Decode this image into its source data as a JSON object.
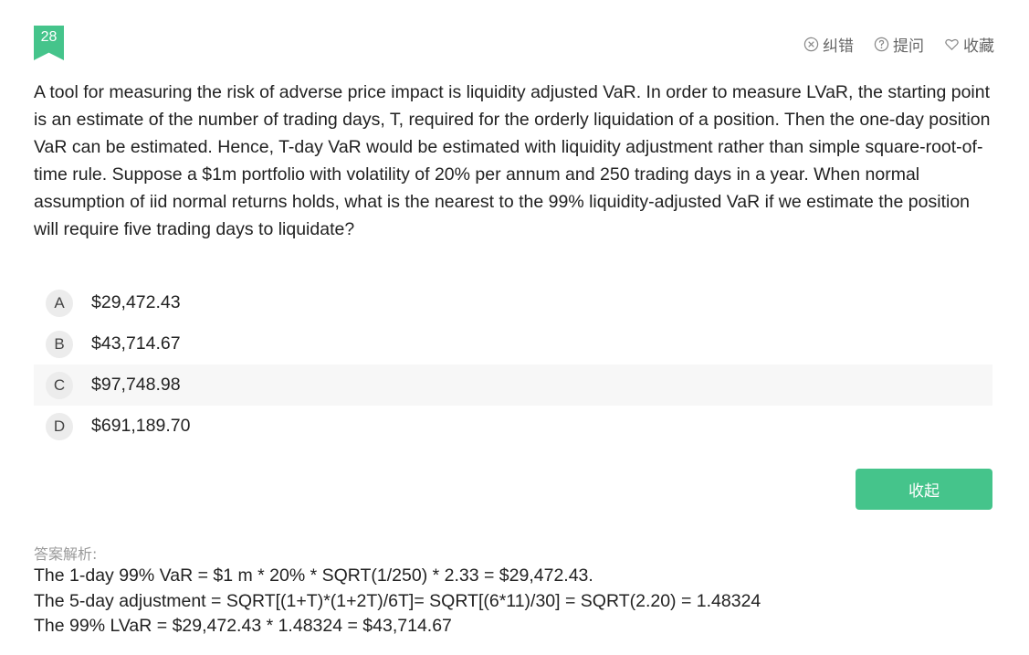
{
  "question_number": "28",
  "actions": [
    {
      "label": "纠错",
      "icon": "x-circle-icon"
    },
    {
      "label": "提问",
      "icon": "question-circle-icon"
    },
    {
      "label": "收藏",
      "icon": "heart-icon"
    }
  ],
  "question_text": "A tool for measuring the risk of adverse price impact is liquidity adjusted VaR. In order to measure LVaR, the starting point is an estimate of the number of trading days, T, required for the orderly liquidation of a position. Then the one-day position VaR can be estimated. Hence, T-day VaR would be estimated with liquidity adjustment rather than simple square-root-of-time rule. Suppose a $1m portfolio with volatility of 20% per annum and 250 trading days in a year. When normal assumption of iid normal returns holds, what is the nearest to the 99% liquidity-adjusted VaR if we estimate the position will require five trading days to liquidate?",
  "options": [
    {
      "letter": "A",
      "text": "$29,472.43"
    },
    {
      "letter": "B",
      "text": "$43,714.67"
    },
    {
      "letter": "C",
      "text": "$97,748.98"
    },
    {
      "letter": "D",
      "text": "$691,189.70"
    }
  ],
  "collapse_label": "收起",
  "explanation_label": "答案解析:",
  "explanation_lines": [
    "The 1-day 99% VaR = $1 m * 20% * SQRT(1/250) * 2.33 = $29,472.43.",
    "The 5-day adjustment = SQRT[(1+T)*(1+2T)/6T]= SQRT[(6*11)/30] = SQRT(2.20) = 1.48324",
    "The 99% LVaR = $29,472.43 * 1.48324 = $43,714.67"
  ]
}
